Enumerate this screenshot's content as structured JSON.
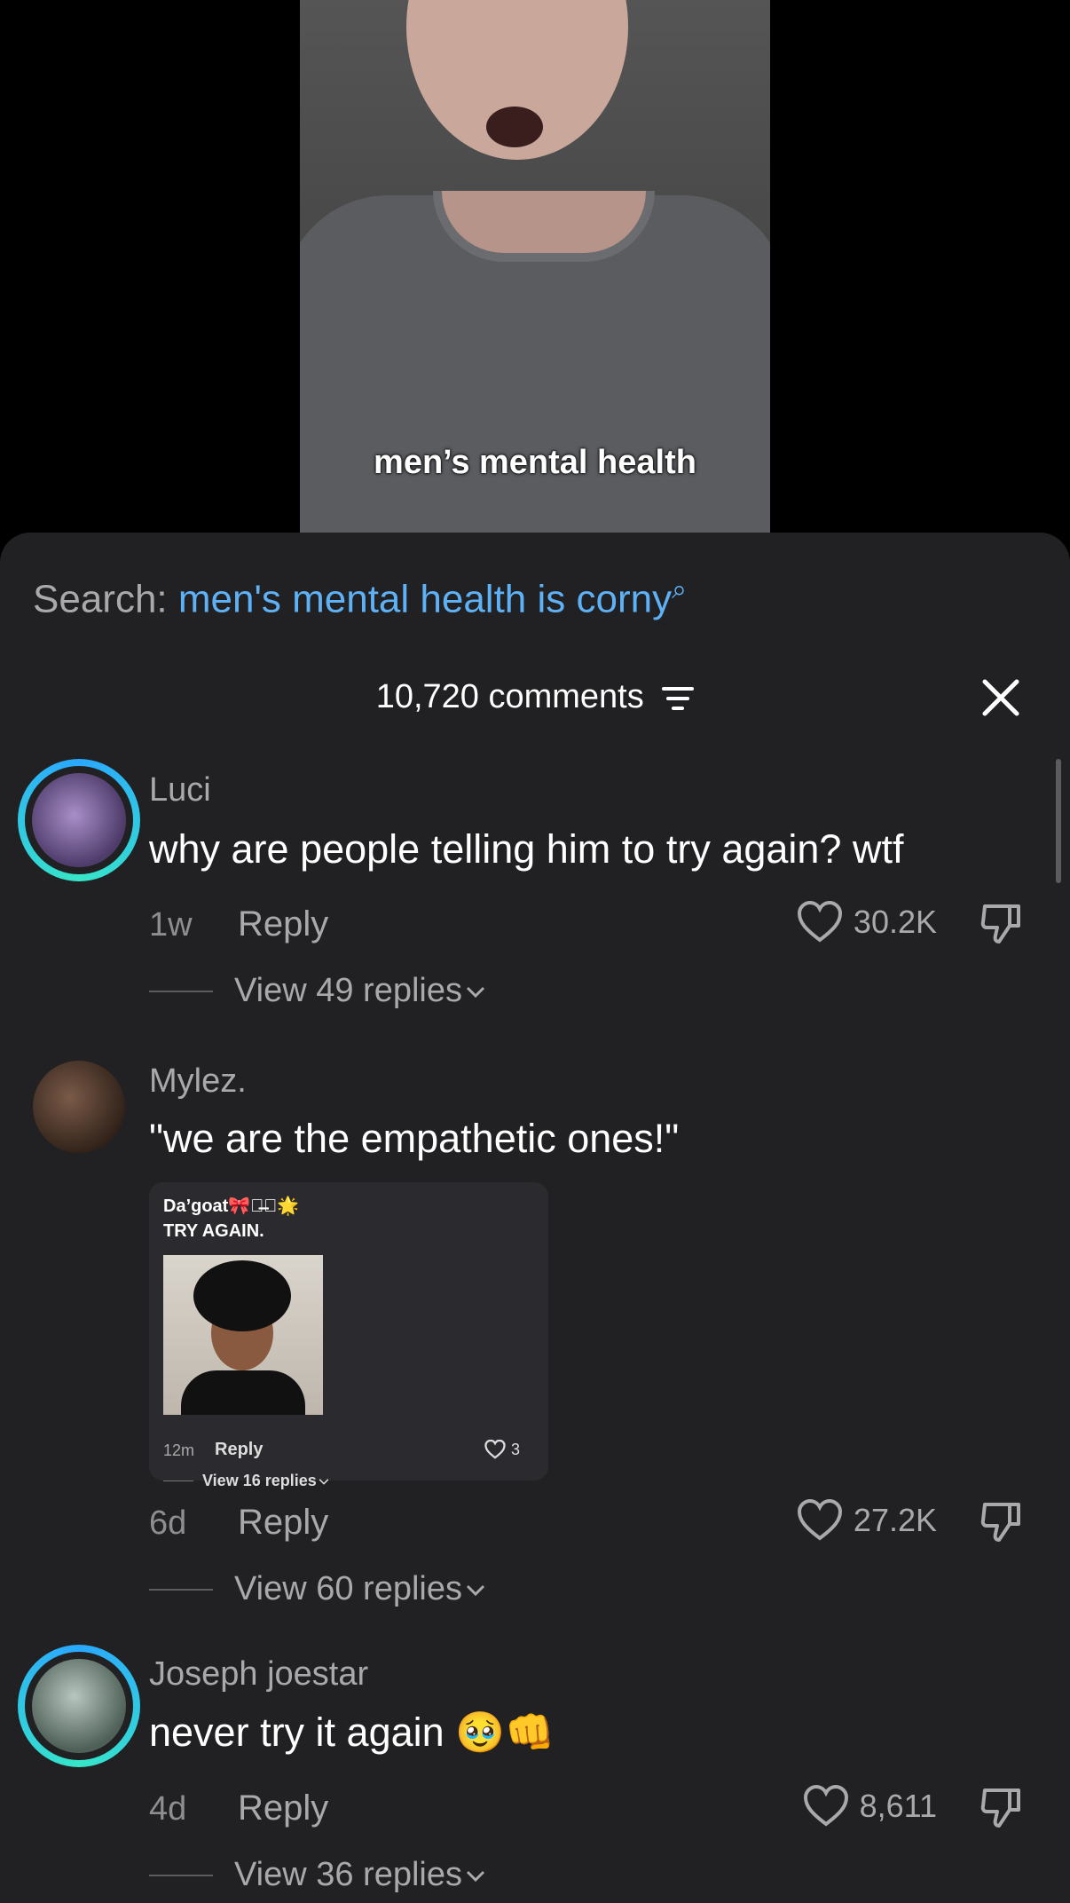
{
  "video": {
    "caption": "men’s mental health"
  },
  "search": {
    "label": "Search:",
    "query": "men's mental health is corny"
  },
  "header": {
    "comment_count": "10,720 comments"
  },
  "comments": [
    {
      "username": "Luci",
      "text": "why are people telling him to try again? wtf",
      "age": "1w",
      "reply_label": "Reply",
      "likes": "30.2K",
      "view_replies": "View 49 replies"
    },
    {
      "username": "Mylez.",
      "text": "\"we are the empathetic ones!\"",
      "age": "6d",
      "reply_label": "Reply",
      "likes": "27.2K",
      "view_replies": "View 60 replies",
      "embed": {
        "username": "Da’goat🎀♡̶⃝🌟",
        "text": "TRY AGAIN.",
        "age": "12m",
        "reply_label": "Reply",
        "likes": "3",
        "view_replies": "View 16 replies"
      }
    },
    {
      "username": "Joseph joestar",
      "text": "never try it again 🥹👊",
      "age": "4d",
      "reply_label": "Reply",
      "likes": "8,611",
      "view_replies": "View 36 replies"
    }
  ],
  "colors": {
    "sheet_bg": "#212123",
    "search_accent": "#5fb1f5",
    "story_ring": "#2aa7ff"
  }
}
